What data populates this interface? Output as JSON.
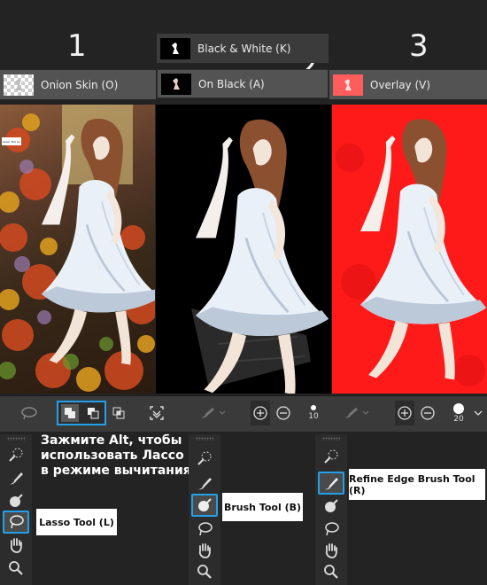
{
  "steps": {
    "one": "1",
    "two": "2",
    "three": "3"
  },
  "view_modes": {
    "onion_skin": "Onion Skin (O)",
    "black_white": "Black & White (K)",
    "on_black": "On Black (A)",
    "overlay": "Overlay (V)"
  },
  "photo_panels": {
    "tooltip_text": "Lasso Tool (L)"
  },
  "options_bar": {
    "size_value": "10",
    "size_value_2": "20"
  },
  "note": {
    "text": "Зажмите Alt, чтобы использовать Лассо в режиме вычитания"
  },
  "callouts": {
    "lasso": "Lasso Tool (L)",
    "brush": "Brush Tool (B)",
    "refine": "Refine Edge Brush Tool (R)"
  },
  "colors": {
    "selection_outline": "#24a0e8",
    "overlay_red": "#ff1a1a",
    "panel_bg": "#2c2c2c"
  }
}
